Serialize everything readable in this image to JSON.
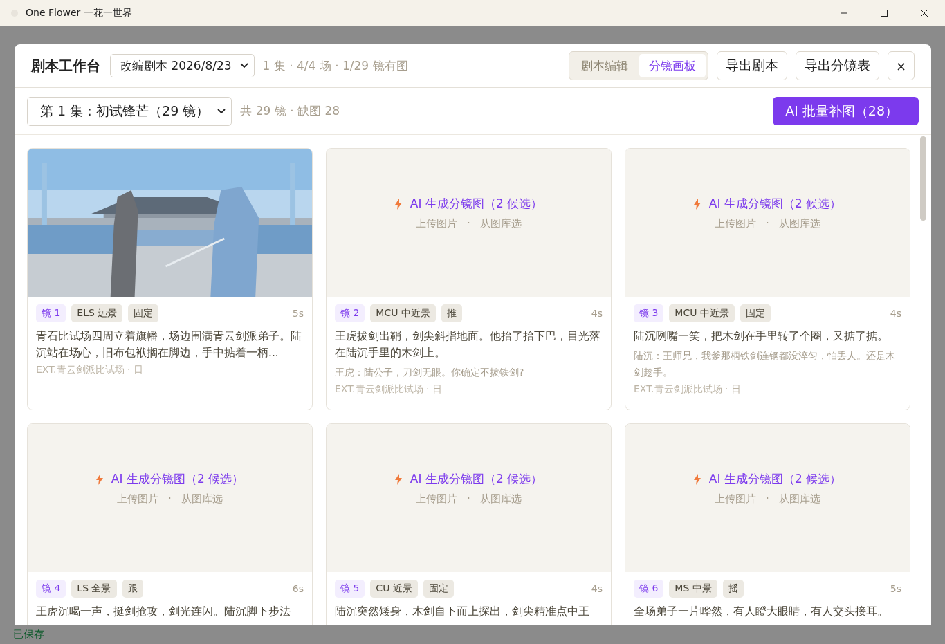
{
  "window": {
    "title": "One Flower 一花一世界"
  },
  "modal": {
    "title": "剧本工作台",
    "script_select": "改编剧本 2026/8/23",
    "stats": "1 集 · 4/4 场 · 1/29 镜有图",
    "view_tabs": [
      {
        "label": "剧本编辑",
        "selected": false
      },
      {
        "label": "分镜画板",
        "selected": true
      }
    ],
    "export_buttons": [
      "导出剧本",
      "导出分镜表"
    ],
    "close": "×",
    "episode_select": "第 1 集：初试锋芒（29 镜）",
    "episode_stats": "共 29 镜 · 缺图 28",
    "batch_button": "AI 批量补图（28）",
    "shots": [
      {
        "number": "镜 1",
        "shot_size": "ELS 远景",
        "movement": "固定",
        "duration": "5s",
        "has_image": true,
        "description": "青石比试场四周立着旗幡，场边围满青云剑派弟子。陆沉站在场心，旧布包袱搁在脚边，手中掂着一柄...",
        "location": "EXT.青云剑派比试场 · 日"
      },
      {
        "number": "镜 2",
        "shot_size": "MCU 中近景",
        "movement": "推",
        "duration": "4s",
        "has_image": false,
        "generate": "AI 生成分镜图（2 候选）",
        "upload": "上传图片",
        "separator": "·",
        "library": "从图库选",
        "description": "王虎拔剑出鞘，剑尖斜指地面。他抬了抬下巴，目光落在陆沉手里的木剑上。",
        "dialogue": "王虎：陆公子，刀剑无眼。你确定不拔铁剑?",
        "location": "EXT.青云剑派比试场 · 日"
      },
      {
        "number": "镜 3",
        "shot_size": "MCU 中近景",
        "movement": "固定",
        "duration": "4s",
        "has_image": false,
        "generate": "AI 生成分镜图（2 候选）",
        "upload": "上传图片",
        "separator": "·",
        "library": "从图库选",
        "description": "陆沉咧嘴一笑，把木剑在手里转了个圈，又掂了掂。",
        "dialogue": "陆沉：王师兄，我爹那柄铁剑连钢都没淬匀，怕丢人。还是木剑趁手。",
        "location": "EXT.青云剑派比试场 · 日"
      },
      {
        "number": "镜 4",
        "shot_size": "LS 全景",
        "movement": "跟",
        "duration": "6s",
        "has_image": false,
        "generate": "AI 生成分镜图（2 候选）",
        "upload": "上传图片",
        "separator": "·",
        "library": "从图库选",
        "description": "王虎沉喝一声，挺剑抢攻，剑光连闪。陆沉脚下步法"
      },
      {
        "number": "镜 5",
        "shot_size": "CU 近景",
        "movement": "固定",
        "duration": "4s",
        "has_image": false,
        "generate": "AI 生成分镜图（2 候选）",
        "upload": "上传图片",
        "separator": "·",
        "library": "从图库选",
        "description": "陆沉突然矮身，木剑自下而上探出，剑尖精准点中王"
      },
      {
        "number": "镜 6",
        "shot_size": "MS 中景",
        "movement": "摇",
        "duration": "5s",
        "has_image": false,
        "generate": "AI 生成分镜图（2 候选）",
        "upload": "上传图片",
        "separator": "·",
        "library": "从图库选",
        "description": "全场弟子一片哗然，有人瞪大眼睛，有人交头接耳。"
      }
    ]
  },
  "status_bar": {
    "text": "已保存"
  }
}
